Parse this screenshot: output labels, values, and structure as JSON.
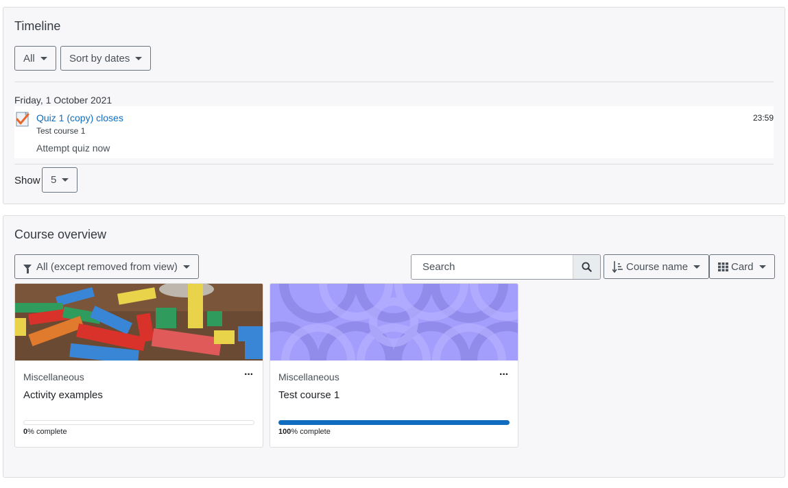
{
  "timeline": {
    "title": "Timeline",
    "filter_label": "All",
    "sort_label": "Sort by dates",
    "date_heading": "Friday, 1 October 2021",
    "event": {
      "icon": "quiz-icon",
      "title": "Quiz 1 (copy) closes",
      "course": "Test course 1",
      "action": "Attempt quiz now",
      "time": "23:59"
    },
    "show_label": "Show",
    "show_value": "5"
  },
  "course_overview": {
    "title": "Course overview",
    "filter_label": "All (except removed from view)",
    "search_placeholder": "Search",
    "sort_label": "Course name",
    "view_label": "Card",
    "courses": [
      {
        "category": "Miscellaneous",
        "name": "Activity examples",
        "progress_percent": 0,
        "progress_value": "0",
        "progress_suffix": "% complete",
        "image": "colorful-wooden-blocks"
      },
      {
        "category": "Miscellaneous",
        "name": "Test course 1",
        "progress_percent": 100,
        "progress_value": "100",
        "progress_suffix": "% complete",
        "image": "purple-circles-pattern"
      }
    ],
    "menu_label": "···"
  },
  "colors": {
    "accent": "#0f6cbf",
    "pattern": "#a39dfc",
    "block_bg": "#f7f7f9"
  }
}
